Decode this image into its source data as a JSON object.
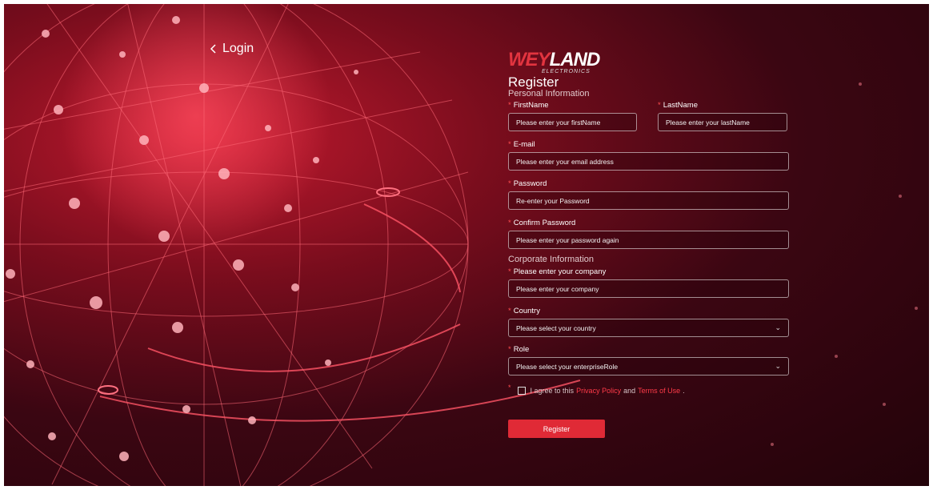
{
  "nav": {
    "back_label": "Login"
  },
  "brand": {
    "wordmark_part1": "WEY",
    "wordmark_part2": "LAND",
    "sub": "ELECTRONICS"
  },
  "form": {
    "title": "Register",
    "personal_section": "Personal Information",
    "corporate_section": "Corporate Information",
    "required_mark": "*",
    "fields": {
      "first_name": {
        "label": "FirstName",
        "placeholder": "Please enter your firstName"
      },
      "last_name": {
        "label": "LastName",
        "placeholder": "Please enter your lastName"
      },
      "email": {
        "label": "E-mail",
        "placeholder": "Please enter your email address"
      },
      "password": {
        "label": "Password",
        "placeholder": "Re-enter your Password"
      },
      "confirm_password": {
        "label": "Confirm Password",
        "placeholder": "Please enter your password again"
      },
      "company": {
        "label": "Please enter your company",
        "placeholder": "Please enter your company"
      },
      "country": {
        "label": "Country",
        "placeholder": "Please select your country"
      },
      "role": {
        "label": "Role",
        "placeholder": "Please select your enterpriseRole"
      }
    },
    "agreement": {
      "prefix": "I agree to this",
      "privacy_link": "Privacy Policy",
      "and": "and",
      "terms_link": "Terms of Use",
      "suffix": "."
    },
    "submit_label": "Register"
  },
  "colors": {
    "accent": "#e02a36",
    "background": "#3b0612",
    "link": "#ff3b48"
  }
}
